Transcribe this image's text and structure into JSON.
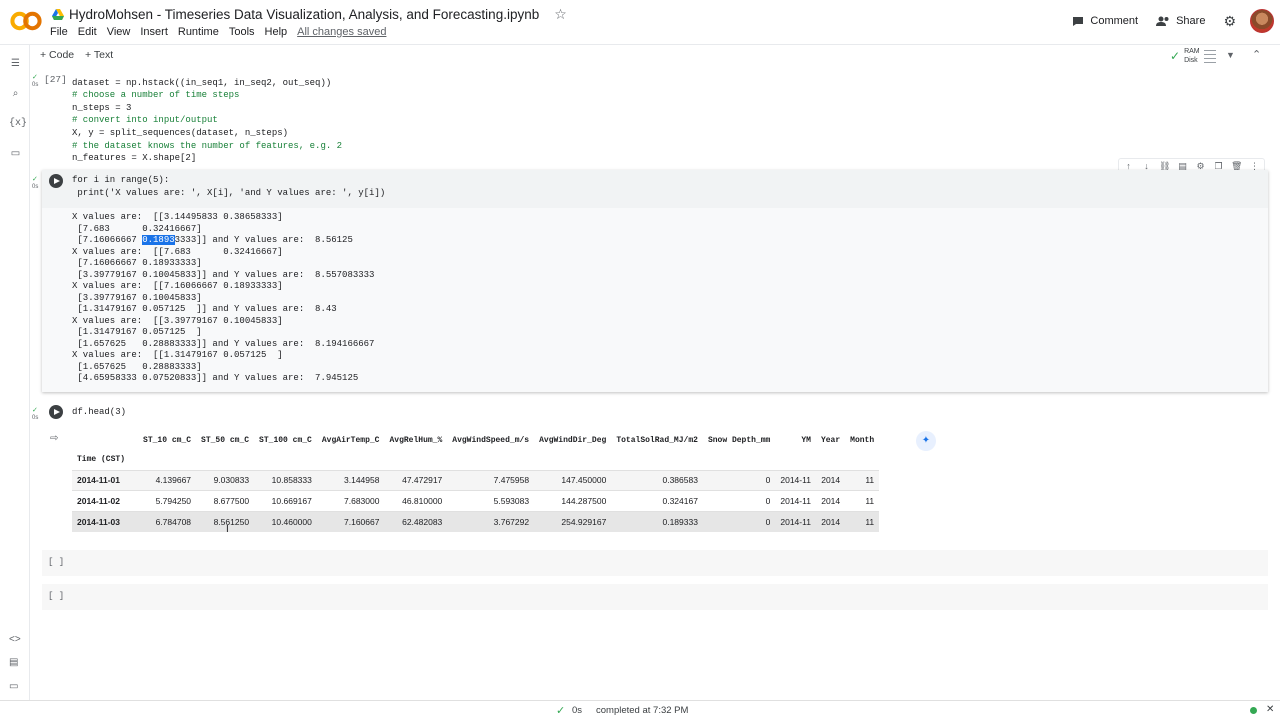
{
  "header": {
    "logo": "CO",
    "notebook_title": "HydroMohsen - Timeseries Data Visualization, Analysis, and Forecasting.ipynb",
    "menu": [
      "File",
      "Edit",
      "View",
      "Insert",
      "Runtime",
      "Tools",
      "Help"
    ],
    "save_status": "All changes saved",
    "comment_label": "Comment",
    "share_label": "Share"
  },
  "toolbar": {
    "add_code": "+ Code",
    "add_text": "+ Text",
    "ram_label": "RAM",
    "disk_label": "Disk"
  },
  "cell1": {
    "prompt": "[27]",
    "exec_time": "0s",
    "lines": [
      "dataset = np.hstack((in_seq1, in_seq2, out_seq))",
      "# choose a number of time steps",
      "n_steps = 3",
      "# convert into input/output",
      "X, y = split_sequences(dataset, n_steps)",
      "# the dataset knows the number of features, e.g. 2",
      "n_features = X.shape[2]"
    ]
  },
  "cell2": {
    "exec_time": "0s",
    "code_line1": "for i in range(5):",
    "code_line2": " print('X values are: ', X[i], 'and Y values are: ', y[i])",
    "output_before_sel": "X values are:  [[3.14495833 0.38658333]\n [7.683      0.32416667]\n [7.16066667 ",
    "output_selected": "0.1893",
    "output_after_sel": "3333]] and Y values are:  8.56125\nX values are:  [[7.683      0.32416667]\n [7.16066667 0.18933333]\n [3.39779167 0.10045833]] and Y values are:  8.557083333\nX values are:  [[7.16066667 0.18933333]\n [3.39779167 0.10045833]\n [1.31479167 0.057125  ]] and Y values are:  8.43\nX values are:  [[3.39779167 0.10045833]\n [1.31479167 0.057125  ]\n [1.657625   0.28883333]] and Y values are:  8.194166667\nX values are:  [[1.31479167 0.057125  ]\n [1.657625   0.28883333]\n [4.65958333 0.07520833]] and Y values are:  7.945125"
  },
  "cell3": {
    "exec_time": "0s",
    "code": "df.head(3)",
    "columns": [
      "ST_10 cm_C",
      "ST_50 cm_C",
      "ST_100 cm_C",
      "AvgAirTemp_C",
      "AvgRelHum_%",
      "AvgWindSpeed_m/s",
      "AvgWindDir_Deg",
      "TotalSolRad_MJ/m2",
      "Snow Depth_mm",
      "YM",
      "Year",
      "Month"
    ],
    "index_name": "Time (CST)",
    "rows": [
      [
        "2014-11-01",
        "4.139667",
        "9.030833",
        "10.858333",
        "3.144958",
        "47.472917",
        "7.475958",
        "147.450000",
        "0.386583",
        "0",
        "2014-11",
        "2014",
        "11"
      ],
      [
        "2014-11-02",
        "5.794250",
        "8.677500",
        "10.669167",
        "7.683000",
        "46.810000",
        "5.593083",
        "144.287500",
        "0.324167",
        "0",
        "2014-11",
        "2014",
        "11"
      ],
      [
        "2014-11-03",
        "6.784708",
        "8.561250",
        "10.460000",
        "7.160667",
        "62.482083",
        "3.767292",
        "254.929167",
        "0.189333",
        "0",
        "2014-11",
        "2014",
        "11"
      ]
    ]
  },
  "empty_cells": [
    "[ ]",
    "[ ]"
  ],
  "status": {
    "time": "0s",
    "message": "completed at 7:32 PM"
  },
  "colors": {
    "accent": "#1a73e8",
    "success": "#34a853",
    "logo_orange": "#f9ab00"
  }
}
